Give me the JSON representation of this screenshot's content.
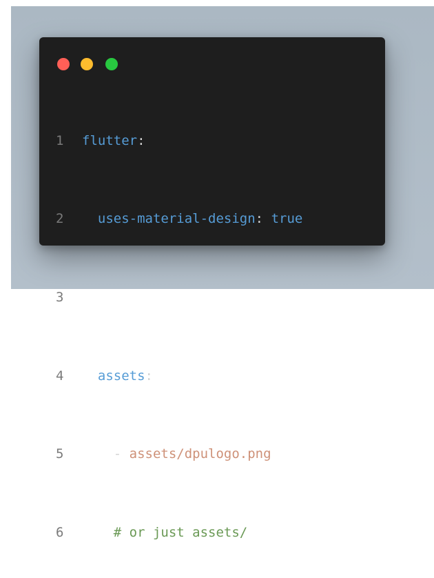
{
  "window_controls": [
    {
      "name": "close",
      "color": "#ff5f57"
    },
    {
      "name": "minimize",
      "color": "#febc2e"
    },
    {
      "name": "maximize",
      "color": "#28c840"
    }
  ],
  "code": {
    "lines": [
      {
        "number": "1",
        "indent": "",
        "key": "flutter",
        "colon": ":"
      },
      {
        "number": "2",
        "indent": "  ",
        "key": "uses-material-design",
        "colon": ":",
        "value": " true"
      },
      {
        "number": "3"
      },
      {
        "number": "4",
        "indent": "  ",
        "key": "assets",
        "colon": ":"
      },
      {
        "number": "5",
        "indent": "    ",
        "dash": "- ",
        "value": "assets/dpulogo.png"
      },
      {
        "number": "6",
        "indent": "    ",
        "comment": "# or just assets/"
      }
    ]
  },
  "colors": {
    "key": "#569cd6",
    "string": "#ce9178",
    "comment": "#6a9955",
    "line_number": "#7a7a7a",
    "background": "#1e1e1e"
  }
}
